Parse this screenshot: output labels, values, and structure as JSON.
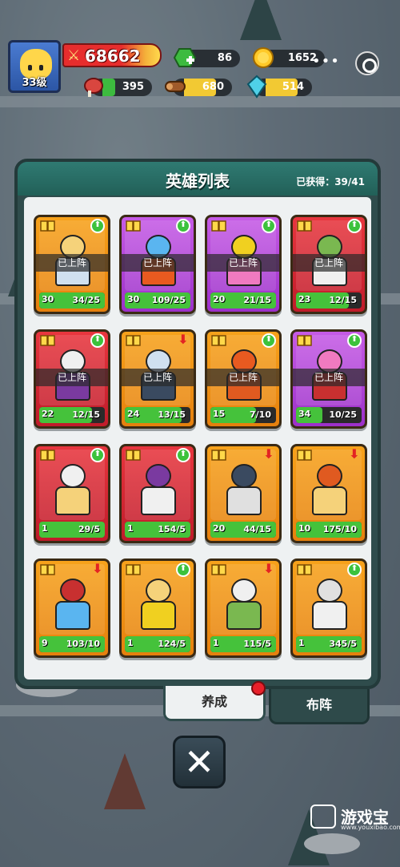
{
  "player": {
    "level_label": "33级",
    "power": "68662",
    "gems": "86",
    "gold": "1652",
    "meat": "395",
    "wood": "680",
    "crystal": "514"
  },
  "panel": {
    "title": "英雄列表",
    "obtained": "已获得：39/41"
  },
  "heroes": [
    {
      "level": "30",
      "fragments": "34/25",
      "deployed": "已上阵",
      "color": "#f7a21b",
      "progress": 1.0
    },
    {
      "level": "30",
      "fragments": "109/25",
      "deployed": "已上阵",
      "color": "#c65be6",
      "progress": 1.0
    },
    {
      "level": "20",
      "fragments": "21/15",
      "deployed": "已上阵",
      "color": "#c65be6",
      "progress": 1.0
    },
    {
      "level": "23",
      "fragments": "12/15",
      "deployed": "已上阵",
      "color": "#e8363e",
      "progress": 0.8
    },
    {
      "level": "22",
      "fragments": "12/15",
      "deployed": "已上阵",
      "color": "#e8363e",
      "progress": 0.8
    },
    {
      "level": "24",
      "fragments": "13/15",
      "deployed": "已上阵",
      "color": "#f7a21b",
      "progress": 0.87
    },
    {
      "level": "15",
      "fragments": "7/10",
      "deployed": "已上阵",
      "color": "#f7a21b",
      "progress": 0.7
    },
    {
      "level": "34",
      "fragments": "10/25",
      "deployed": "已上阵",
      "color": "#c65be6",
      "progress": 0.4
    },
    {
      "level": "1",
      "fragments": "29/5",
      "deployed": "",
      "color": "#e8363e",
      "progress": 1.0
    },
    {
      "level": "1",
      "fragments": "154/5",
      "deployed": "",
      "color": "#e8363e",
      "progress": 1.0
    },
    {
      "level": "20",
      "fragments": "44/15",
      "deployed": "",
      "color": "#f7a21b",
      "progress": 1.0
    },
    {
      "level": "10",
      "fragments": "175/10",
      "deployed": "",
      "color": "#f7a21b",
      "progress": 1.0
    },
    {
      "level": "9",
      "fragments": "103/10",
      "deployed": "",
      "color": "#f7a21b",
      "progress": 1.0
    },
    {
      "level": "1",
      "fragments": "124/5",
      "deployed": "",
      "color": "#f7a21b",
      "progress": 1.0
    },
    {
      "level": "1",
      "fragments": "115/5",
      "deployed": "",
      "color": "#f7a21b",
      "progress": 1.0
    },
    {
      "level": "1",
      "fragments": "345/5",
      "deployed": "",
      "color": "#f7a21b",
      "progress": 1.0
    }
  ],
  "tabs": {
    "train": "养成",
    "formation": "布阵"
  },
  "watermark": {
    "name": "游戏宝",
    "url": "www.youxibao.com"
  },
  "icons": {
    "close": "close-icon",
    "target": "target-icon"
  }
}
